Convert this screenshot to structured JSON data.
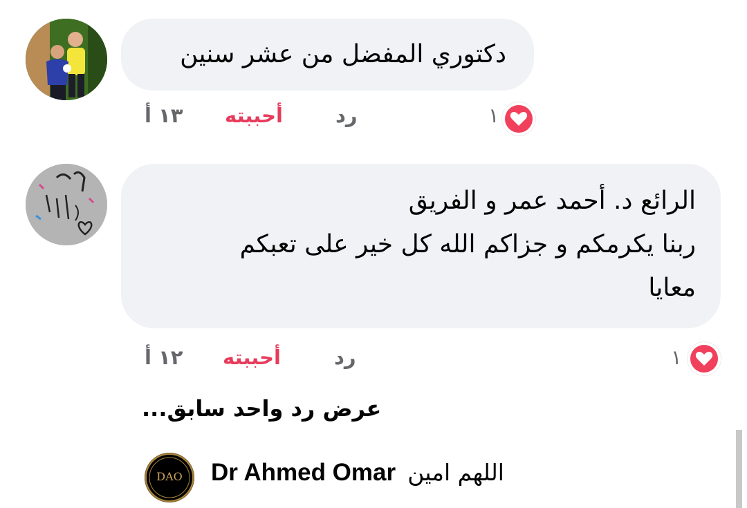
{
  "comments": [
    {
      "text": "دكتوري المفضل من عشر سنين",
      "time": "١٣ أ",
      "like_label": "أحببته",
      "reply_label": "رد",
      "reaction_count": "١",
      "reaction_icon": "heart-icon"
    },
    {
      "text_lines": [
        "الرائع د. أحمد عمر و الفريق",
        "ربنا يكرمكم و جزاكم الله كل خير على تعبكم",
        "معايا"
      ],
      "time": "١٢ أ",
      "like_label": "أحببته",
      "reply_label": "رد",
      "reaction_count": "١",
      "reaction_icon": "heart-icon"
    }
  ],
  "view_previous_replies": "عرض رد واحد سابق...",
  "reply_preview": {
    "author": "Dr Ahmed Omar",
    "text": "اللهم امين",
    "logo_text": "DAO"
  },
  "colors": {
    "like_accent": "#e73b5c",
    "bubble_bg": "#f0f2f5",
    "muted_text": "#65676b",
    "heart": "#f1405b"
  }
}
